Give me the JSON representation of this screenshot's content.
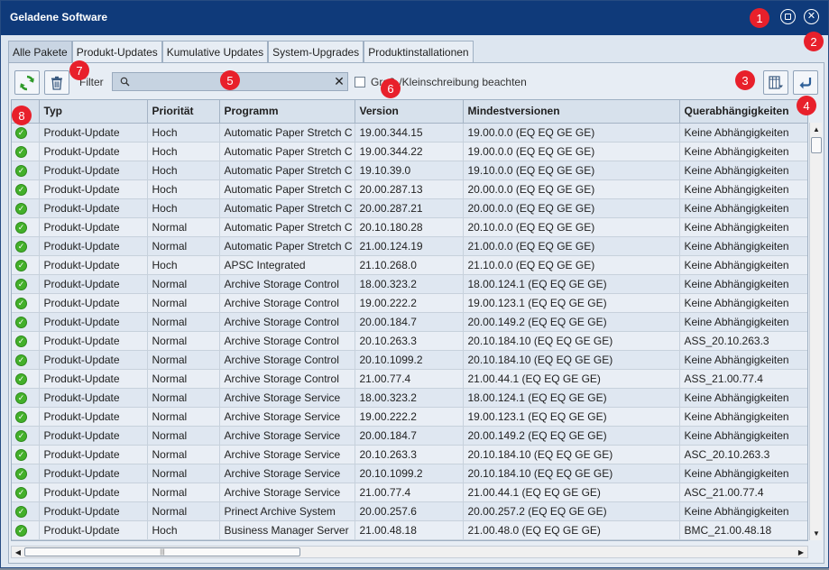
{
  "window": {
    "title": "Geladene Software"
  },
  "tabs": [
    {
      "label": "Alle Pakete",
      "active": true
    },
    {
      "label": "Produkt-Updates",
      "active": false
    },
    {
      "label": "Kumulative Updates",
      "active": false
    },
    {
      "label": "System-Upgrades",
      "active": false
    },
    {
      "label": "Produktinstallationen",
      "active": false
    }
  ],
  "toolbar": {
    "filter_label": "Filter",
    "search_value": "",
    "case_sensitive_label": "Groß-/Kleinschreibung beachten",
    "case_sensitive_checked": false
  },
  "markers": [
    "1",
    "2",
    "3",
    "4",
    "5",
    "6",
    "7",
    "8"
  ],
  "table": {
    "columns": [
      "",
      "Typ",
      "Priorität",
      "Programm",
      "Version",
      "Mindestversionen",
      "Querabhängigkeiten"
    ],
    "rows": [
      [
        "Produkt-Update",
        "Hoch",
        "Automatic Paper Stretch C",
        "19.00.344.15",
        "19.00.0.0 (EQ EQ GE GE)",
        "Keine Abhängigkeiten"
      ],
      [
        "Produkt-Update",
        "Hoch",
        "Automatic Paper Stretch C",
        "19.00.344.22",
        "19.00.0.0 (EQ EQ GE GE)",
        "Keine Abhängigkeiten"
      ],
      [
        "Produkt-Update",
        "Hoch",
        "Automatic Paper Stretch C",
        "19.10.39.0",
        "19.10.0.0 (EQ EQ GE GE)",
        "Keine Abhängigkeiten"
      ],
      [
        "Produkt-Update",
        "Hoch",
        "Automatic Paper Stretch C",
        "20.00.287.13",
        "20.00.0.0 (EQ EQ GE GE)",
        "Keine Abhängigkeiten"
      ],
      [
        "Produkt-Update",
        "Hoch",
        "Automatic Paper Stretch C",
        "20.00.287.21",
        "20.00.0.0 (EQ EQ GE GE)",
        "Keine Abhängigkeiten"
      ],
      [
        "Produkt-Update",
        "Normal",
        "Automatic Paper Stretch C",
        "20.10.180.28",
        "20.10.0.0 (EQ EQ GE GE)",
        "Keine Abhängigkeiten"
      ],
      [
        "Produkt-Update",
        "Normal",
        "Automatic Paper Stretch C",
        "21.00.124.19",
        "21.00.0.0 (EQ EQ GE GE)",
        "Keine Abhängigkeiten"
      ],
      [
        "Produkt-Update",
        "Hoch",
        "APSC Integrated",
        "21.10.268.0",
        "21.10.0.0 (EQ EQ GE GE)",
        "Keine Abhängigkeiten"
      ],
      [
        "Produkt-Update",
        "Normal",
        "Archive Storage Control",
        "18.00.323.2",
        "18.00.124.1 (EQ EQ GE GE)",
        "Keine Abhängigkeiten"
      ],
      [
        "Produkt-Update",
        "Normal",
        "Archive Storage Control",
        "19.00.222.2",
        "19.00.123.1 (EQ EQ GE GE)",
        "Keine Abhängigkeiten"
      ],
      [
        "Produkt-Update",
        "Normal",
        "Archive Storage Control",
        "20.00.184.7",
        "20.00.149.2 (EQ EQ GE GE)",
        "Keine Abhängigkeiten"
      ],
      [
        "Produkt-Update",
        "Normal",
        "Archive Storage Control",
        "20.10.263.3",
        "20.10.184.10 (EQ EQ GE GE)",
        "ASS_20.10.263.3"
      ],
      [
        "Produkt-Update",
        "Normal",
        "Archive Storage Control",
        "20.10.1099.2",
        "20.10.184.10 (EQ EQ GE GE)",
        "Keine Abhängigkeiten"
      ],
      [
        "Produkt-Update",
        "Normal",
        "Archive Storage Control",
        "21.00.77.4",
        "21.00.44.1 (EQ EQ GE GE)",
        "ASS_21.00.77.4"
      ],
      [
        "Produkt-Update",
        "Normal",
        "Archive Storage Service",
        "18.00.323.2",
        "18.00.124.1 (EQ EQ GE GE)",
        "Keine Abhängigkeiten"
      ],
      [
        "Produkt-Update",
        "Normal",
        "Archive Storage Service",
        "19.00.222.2",
        "19.00.123.1 (EQ EQ GE GE)",
        "Keine Abhängigkeiten"
      ],
      [
        "Produkt-Update",
        "Normal",
        "Archive Storage Service",
        "20.00.184.7",
        "20.00.149.2 (EQ EQ GE GE)",
        "Keine Abhängigkeiten"
      ],
      [
        "Produkt-Update",
        "Normal",
        "Archive Storage Service",
        "20.10.263.3",
        "20.10.184.10 (EQ EQ GE GE)",
        "ASC_20.10.263.3"
      ],
      [
        "Produkt-Update",
        "Normal",
        "Archive Storage Service",
        "20.10.1099.2",
        "20.10.184.10 (EQ EQ GE GE)",
        "Keine Abhängigkeiten"
      ],
      [
        "Produkt-Update",
        "Normal",
        "Archive Storage Service",
        "21.00.77.4",
        "21.00.44.1 (EQ EQ GE GE)",
        "ASC_21.00.77.4"
      ],
      [
        "Produkt-Update",
        "Normal",
        "Prinect Archive System",
        "20.00.257.6",
        "20.00.257.2 (EQ EQ GE GE)",
        "Keine Abhängigkeiten"
      ],
      [
        "Produkt-Update",
        "Hoch",
        "Business Manager Server",
        "21.00.48.18",
        "21.00.48.0 (EQ EQ GE GE)",
        "BMC_21.00.48.18"
      ]
    ]
  },
  "colors": {
    "titlebar": "#0f3a7a",
    "marker": "#e8202b",
    "status_ok": "#43b02a"
  }
}
